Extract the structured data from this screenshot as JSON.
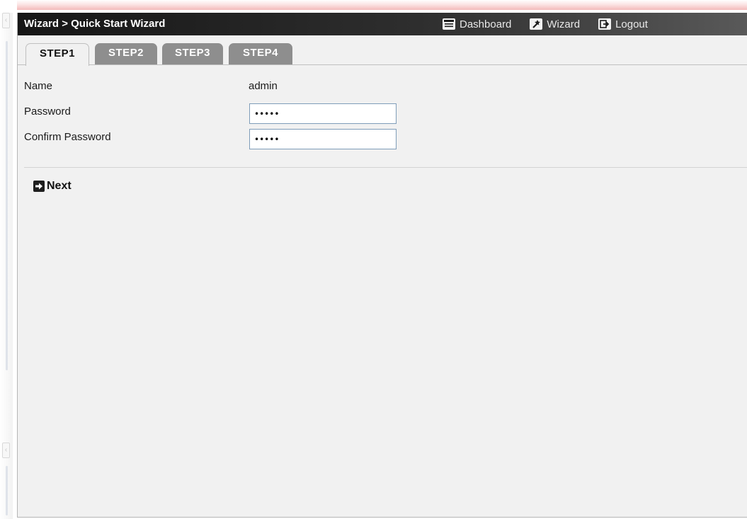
{
  "header": {
    "breadcrumb": "Wizard > Quick Start Wizard",
    "links": [
      {
        "label": "Dashboard",
        "icon": "dashboard-icon"
      },
      {
        "label": "Wizard",
        "icon": "wand-icon"
      },
      {
        "label": "Logout",
        "icon": "logout-icon"
      }
    ]
  },
  "tabs": [
    {
      "label": "STEP1",
      "active": true
    },
    {
      "label": "STEP2",
      "active": false
    },
    {
      "label": "STEP3",
      "active": false
    },
    {
      "label": "STEP4",
      "active": false
    }
  ],
  "form": {
    "name_label": "Name",
    "name_value": "admin",
    "password_label": "Password",
    "password_value": "•••••",
    "confirm_label": "Confirm Password",
    "confirm_value": "•••••"
  },
  "actions": {
    "next_label": "Next",
    "next_icon": "arrow-right-icon"
  },
  "colors": {
    "titlebar": "#161616",
    "panel_bg": "#f1f1f1",
    "tab_inactive": "#8e8e8e",
    "input_border": "#7f9db9",
    "top_glow": "#f3b9b9"
  }
}
